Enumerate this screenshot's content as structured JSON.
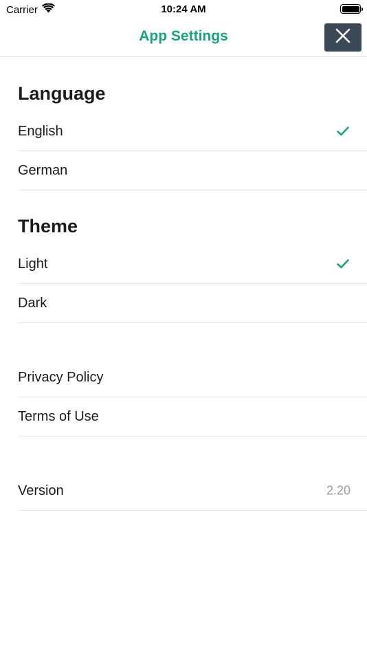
{
  "status_bar": {
    "carrier": "Carrier",
    "time": "10:24 AM",
    "battery_level": 1.0
  },
  "nav": {
    "title": "App Settings",
    "close_icon": "close-icon",
    "title_color": "#1aa47e",
    "close_bg": "#3a4955"
  },
  "language": {
    "header": "Language",
    "options": [
      {
        "label": "English",
        "selected": true
      },
      {
        "label": "German",
        "selected": false
      }
    ]
  },
  "theme": {
    "header": "Theme",
    "options": [
      {
        "label": "Light",
        "selected": true
      },
      {
        "label": "Dark",
        "selected": false
      }
    ]
  },
  "legal": {
    "items": [
      {
        "label": "Privacy Policy"
      },
      {
        "label": "Terms of Use"
      }
    ]
  },
  "about": {
    "version_label": "Version",
    "version_value": "2.20"
  },
  "colors": {
    "accent": "#1aa47e",
    "divider": "#e3e3e6",
    "secondary_text": "#9b9ba0"
  }
}
